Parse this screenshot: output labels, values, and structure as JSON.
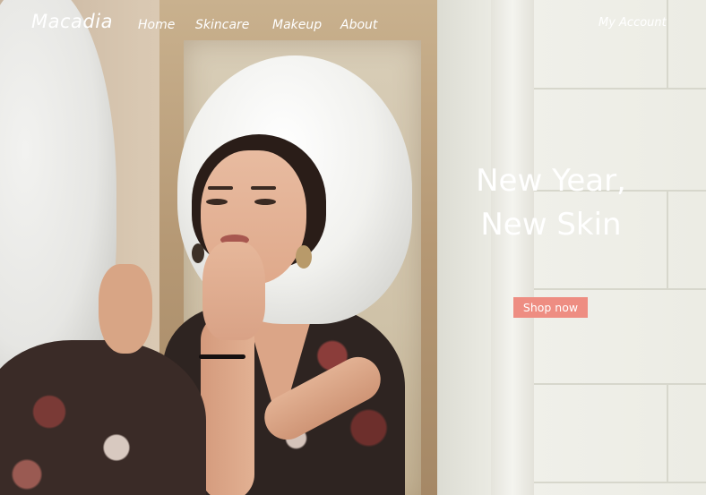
{
  "brand": {
    "name": "Macadia"
  },
  "nav": {
    "items": [
      {
        "label": "Home"
      },
      {
        "label": "Skincare"
      },
      {
        "label": "Makeup"
      },
      {
        "label": "About"
      }
    ]
  },
  "account": {
    "label": "My Account"
  },
  "hero": {
    "headline_line1": "New Year,",
    "headline_line2": "New Skin",
    "cta_label": "Shop now",
    "cta_color": "#ee8d82",
    "image_icon": "hero-photo"
  }
}
